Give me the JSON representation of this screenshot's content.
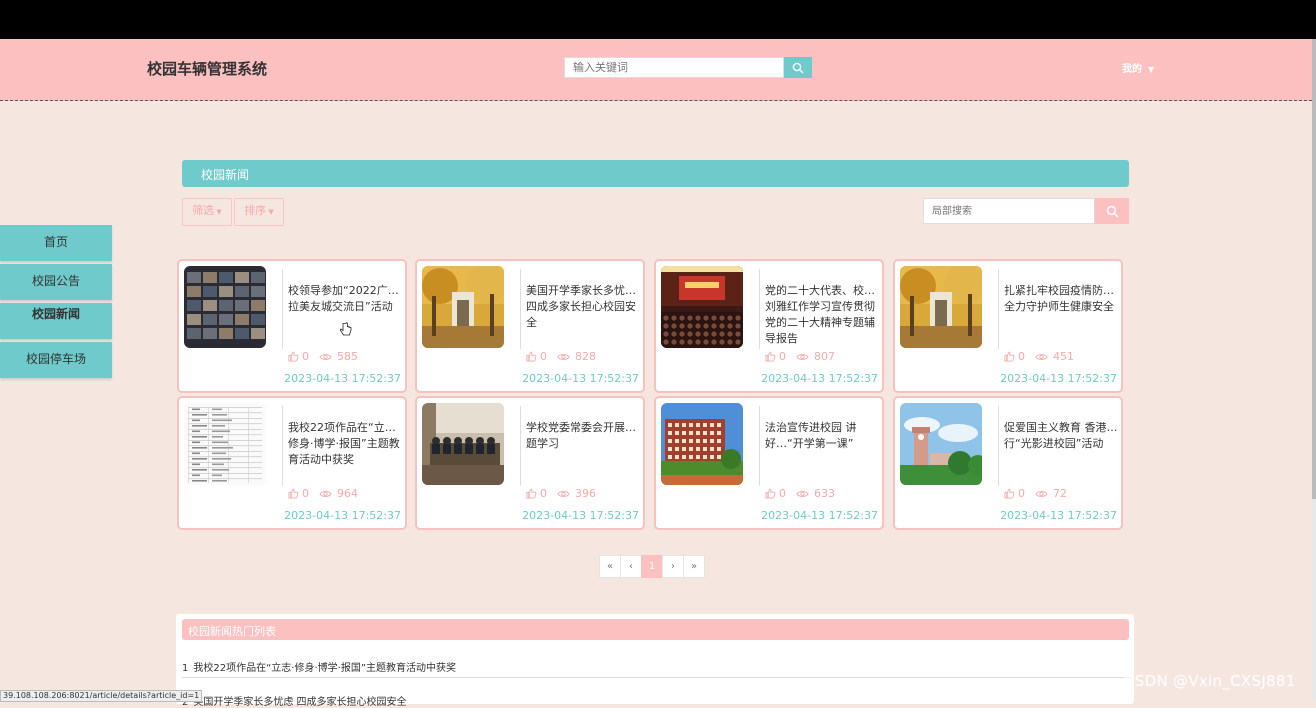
{
  "header": {
    "site_title": "校园车辆管理系统",
    "search_placeholder": "输入关键词",
    "user_menu": "我的"
  },
  "sidebar": {
    "items": [
      {
        "label": "首页"
      },
      {
        "label": "校园公告"
      },
      {
        "label": "校园新闻"
      },
      {
        "label": "校园停车场"
      }
    ],
    "active": "校园新闻"
  },
  "section": {
    "title": "校园新闻",
    "filter_label": "筛选",
    "sort_label": "排序",
    "local_search_placeholder": "局部搜索"
  },
  "cards": [
    {
      "title": "校领导参加“2022广…拉美友城交流日”活动",
      "likes": "0",
      "views": "585",
      "date": "2023-04-13 17:52:37",
      "thumb": "video-meeting"
    },
    {
      "title": "美国开学季家长多忧…四成多家长担心校园安全",
      "likes": "0",
      "views": "828",
      "date": "2023-04-13 17:52:37",
      "thumb": "autumn-gate"
    },
    {
      "title": "党的二十大代表、校…刘雅红作学习宣传贯彻党的二十大精神专题辅导报告",
      "likes": "0",
      "views": "807",
      "date": "2023-04-13 17:52:37",
      "thumb": "auditorium"
    },
    {
      "title": "扎紧扎牢校园疫情防…全力守护师生健康安全",
      "likes": "0",
      "views": "451",
      "date": "2023-04-13 17:52:37",
      "thumb": "autumn-gate"
    },
    {
      "title": "我校22项作品在“立…修身·博学·报国”主题教育活动中获奖",
      "likes": "0",
      "views": "964",
      "date": "2023-04-13 17:52:37",
      "thumb": "document"
    },
    {
      "title": "学校党委常委会开展…题学习",
      "likes": "0",
      "views": "396",
      "date": "2023-04-13 17:52:37",
      "thumb": "meeting-room"
    },
    {
      "title": "法治宣传进校园 讲好…“开学第一课”",
      "likes": "0",
      "views": "633",
      "date": "2023-04-13 17:52:37",
      "thumb": "campus-building"
    },
    {
      "title": "促爱国主义教育 香港…行“光影进校园”活动",
      "likes": "0",
      "views": "72",
      "date": "2023-04-13 17:52:37",
      "thumb": "tower-sky"
    }
  ],
  "pagination": {
    "first": "«",
    "prev": "‹",
    "current": "1",
    "next": "›",
    "last": "»"
  },
  "hot_list": {
    "title": "校园新闻热门列表",
    "items": [
      {
        "index": "1",
        "text": "我校22项作品在“立志·修身·博学·报国”主题教育活动中获奖"
      },
      {
        "index": "2",
        "text": "美国开学季家长多忧虑 四成多家长担心校园安全"
      }
    ]
  },
  "status_url": "39.108.108.206:8021/article/details?article_id=1",
  "watermark": "CSDN @Vxin_CXSJ881",
  "colors": {
    "header_bg": "#fdc0c0",
    "accent_teal": "#6fcacb",
    "page_bg": "#f6e6e0",
    "card_border": "#f6c1c1"
  }
}
